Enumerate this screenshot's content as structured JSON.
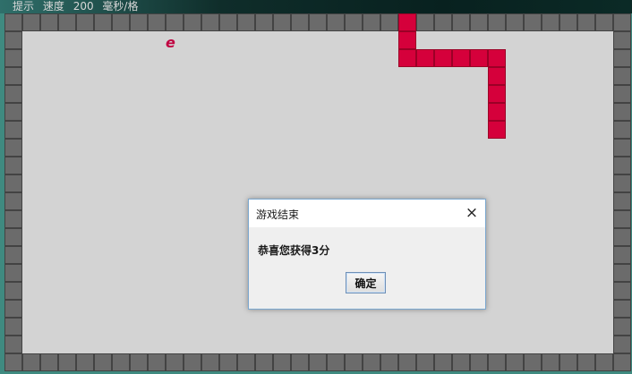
{
  "status_bar": {
    "hint_label": "提示",
    "speed_label": "速度",
    "speed_value": "200",
    "speed_unit": "毫秒/格"
  },
  "game": {
    "food_char": "e",
    "colors": {
      "board": "#d3d3d3",
      "wall": "#6b6b6b",
      "snake": "#d5003b",
      "food": "#c00040"
    }
  },
  "dialog": {
    "title": "游戏结束",
    "message": "恭喜您获得3分",
    "ok_label": "确定",
    "close_icon": "×"
  }
}
